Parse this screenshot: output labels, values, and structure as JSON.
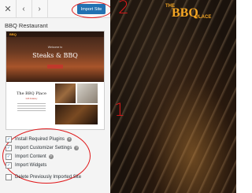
{
  "toolbar": {
    "close_icon": "✕",
    "back_icon": "‹",
    "forward_icon": "›",
    "import_label": "Import Site"
  },
  "site": {
    "title": "BBQ Restaurant"
  },
  "preview": {
    "logo": "BBQ",
    "welcome": "Welcome to",
    "heading": "Steaks & BBQ",
    "section_title": "The BBQ Place",
    "section_sub": "Grill & Eatery"
  },
  "options": [
    {
      "label": "Install Required Plugins",
      "checked": true,
      "help": true
    },
    {
      "label": "Import Customizer Settings",
      "checked": true,
      "help": true
    },
    {
      "label": "Import Content",
      "checked": true,
      "help": true
    },
    {
      "label": "Import Widgets",
      "checked": true,
      "help": false
    },
    {
      "label": "Delete Previously Imported Site",
      "checked": false,
      "help": false
    }
  ],
  "annotations": {
    "one": "1",
    "two": "2"
  },
  "brand": {
    "the": "THE",
    "bbq": "BBQ",
    "place": "PLACE",
    "accent": "#f5a623",
    "primary": "#2271b1",
    "marker": "#e0191b"
  }
}
